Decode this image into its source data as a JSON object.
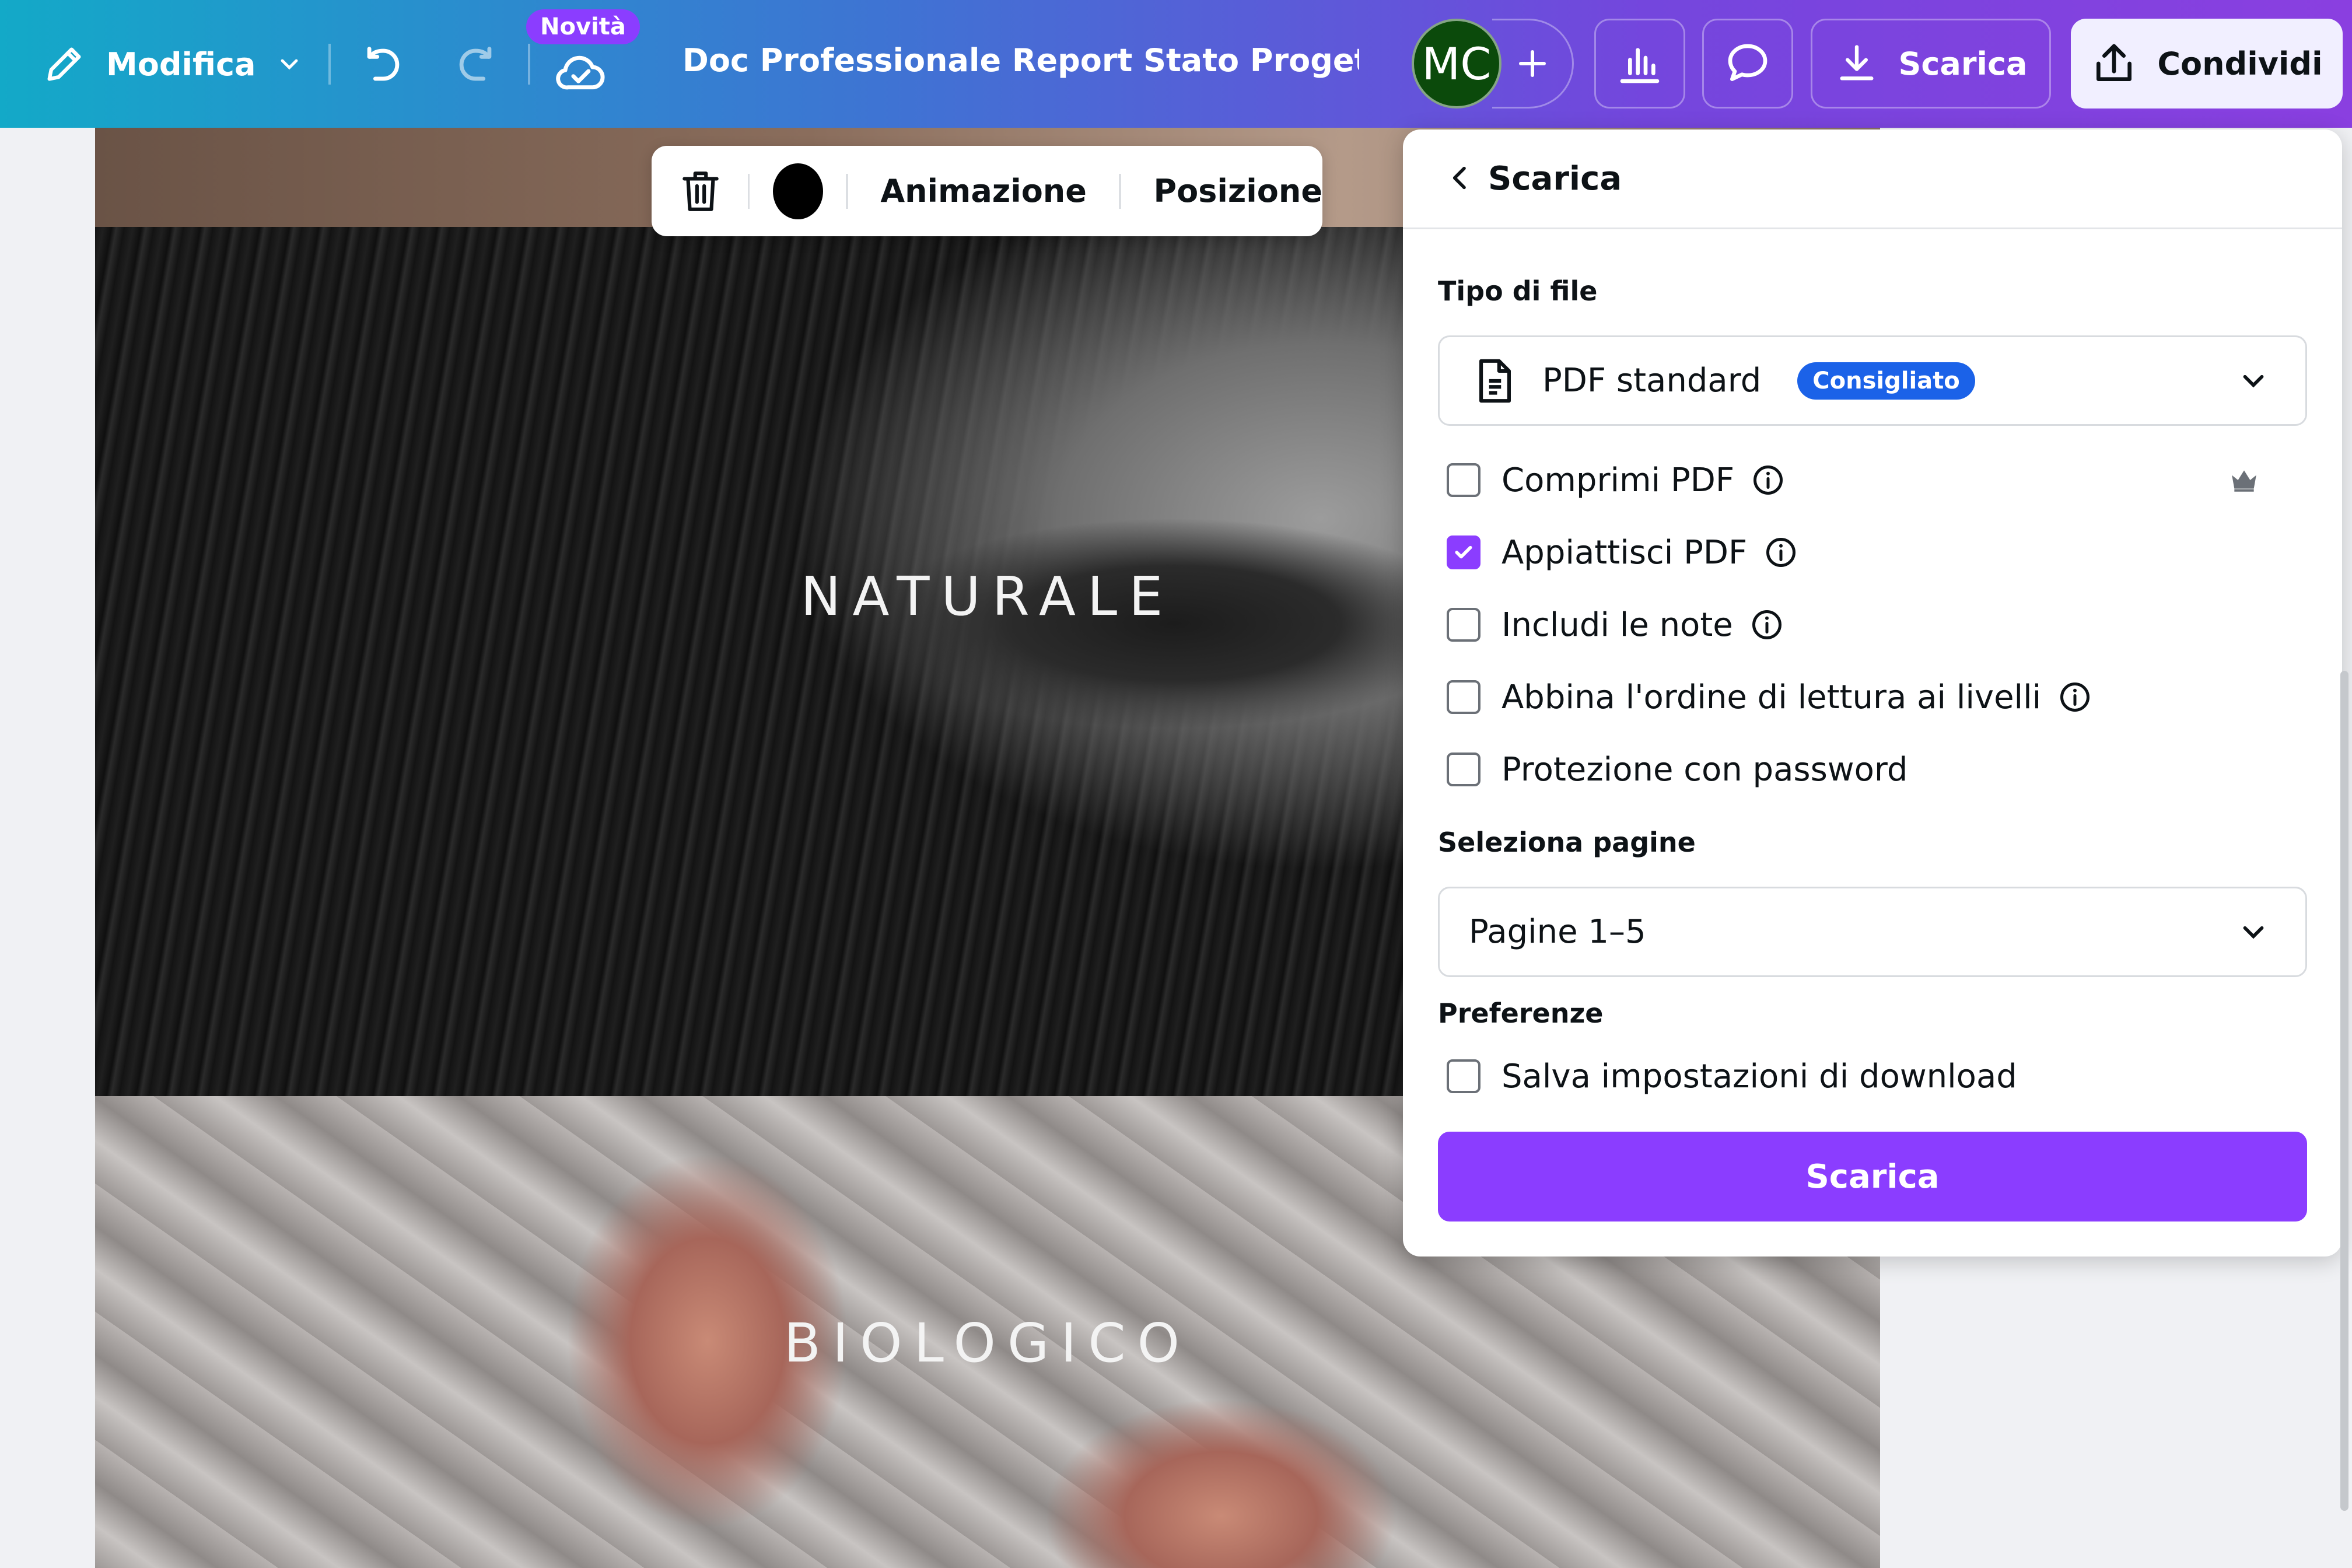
{
  "topbar": {
    "edit_label": "Modifica",
    "new_badge": "Novità",
    "document_title": "Doc Professionale Report Stato Progetto i...",
    "avatar_initials": "MC",
    "download_label": "Scarica",
    "share_label": "Condividi"
  },
  "canvas": {
    "word_1": "NATURALE",
    "word_2": "BIOLOGICO"
  },
  "floating_toolbar": {
    "color_swatch": "#000000",
    "animation_label": "Animazione",
    "position_label": "Posizione"
  },
  "download_panel": {
    "title": "Scarica",
    "file_type_label": "Tipo di file",
    "file_type_value": "PDF standard",
    "recommended_badge": "Consigliato",
    "options": [
      {
        "label": "Comprimi PDF",
        "checked": false,
        "info": true,
        "premium": true
      },
      {
        "label": "Appiattisci PDF",
        "checked": true,
        "info": true,
        "premium": false
      },
      {
        "label": "Includi le note",
        "checked": false,
        "info": true,
        "premium": false
      },
      {
        "label": "Abbina l'ordine di lettura ai livelli",
        "checked": false,
        "info": true,
        "premium": false
      },
      {
        "label": "Protezione con password",
        "checked": false,
        "info": false,
        "premium": false
      }
    ],
    "pages_label": "Seleziona pagine",
    "pages_value": "Pagine 1–5",
    "preferences_label": "Preferenze",
    "save_settings_label": "Salva impostazioni di download",
    "save_settings_checked": false,
    "download_button": "Scarica"
  },
  "colors": {
    "accent": "#8b3dff",
    "badge_blue": "#1b62e8"
  }
}
